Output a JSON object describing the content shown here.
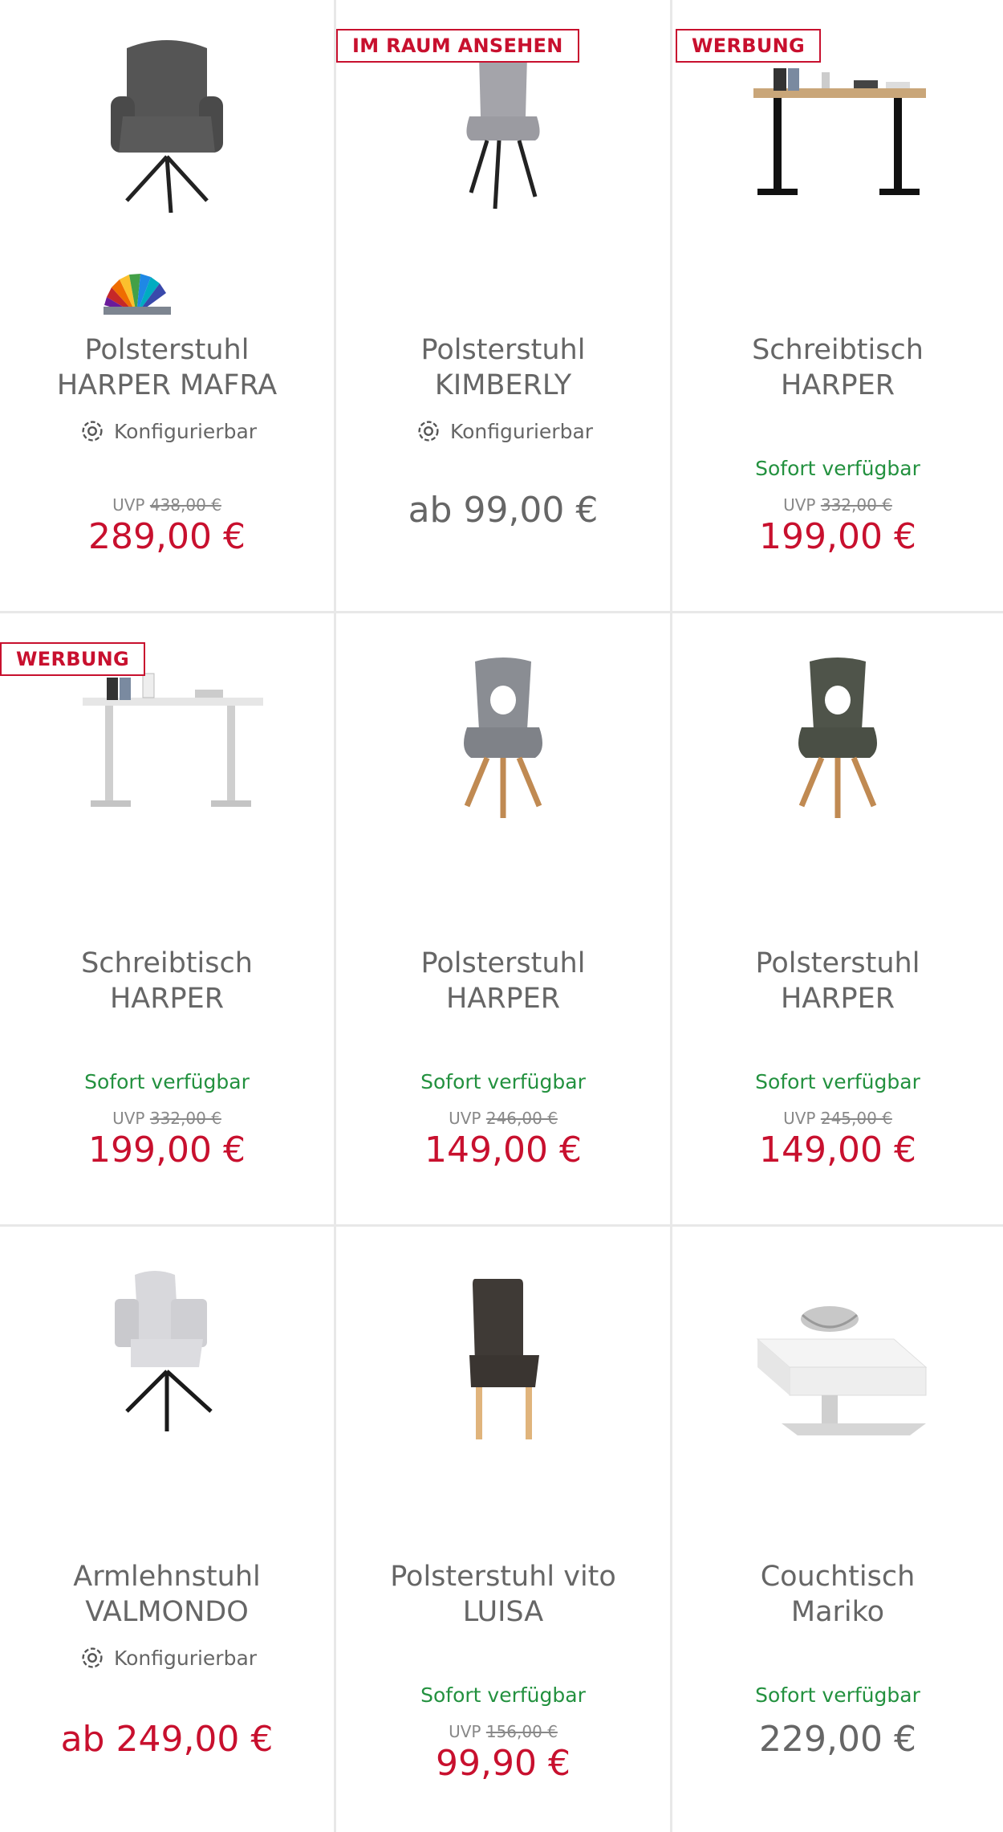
{
  "products": [
    {
      "title1": "Polsterstuhl",
      "title2": "HARPER MAFRA",
      "badge": "",
      "config": "Konfigurierbar",
      "availability": "",
      "uvp_label": "UVP",
      "uvp": "438,00 €",
      "price": "289,00 €",
      "image": "armchair-grey-icon"
    },
    {
      "title1": "Polsterstuhl",
      "title2": "KIMBERLY",
      "badge": "IM RAUM ANSEHEN",
      "config": "Konfigurierbar",
      "availability": "",
      "uvp_label": "",
      "uvp": "",
      "price": "ab 99,00 €",
      "image": "chair-light-grey-icon"
    },
    {
      "title1": "Schreibtisch",
      "title2": "HARPER",
      "badge": "WERBUNG",
      "config": "",
      "availability": "Sofort verfügbar",
      "uvp_label": "UVP",
      "uvp": "332,00 €",
      "price": "199,00 €",
      "image": "desk-black-icon"
    },
    {
      "title1": "Schreibtisch",
      "title2": "HARPER",
      "badge": "WERBUNG",
      "config": "",
      "availability": "Sofort verfügbar",
      "uvp_label": "UVP",
      "uvp": "332,00 €",
      "price": "199,00 €",
      "image": "desk-white-icon"
    },
    {
      "title1": "Polsterstuhl",
      "title2": "HARPER",
      "badge": "",
      "config": "",
      "availability": "Sofort verfügbar",
      "uvp_label": "UVP",
      "uvp": "246,00 €",
      "price": "149,00 €",
      "image": "chair-grey-wood-icon"
    },
    {
      "title1": "Polsterstuhl",
      "title2": "HARPER",
      "badge": "",
      "config": "",
      "availability": "Sofort verfügbar",
      "uvp_label": "UVP",
      "uvp": "245,00 €",
      "price": "149,00 €",
      "image": "chair-olive-wood-icon"
    },
    {
      "title1": "Armlehnstuhl",
      "title2": "VALMONDO",
      "badge": "",
      "config": "Konfigurierbar",
      "availability": "",
      "uvp_label": "",
      "uvp": "",
      "price": "ab 249,00 €",
      "image": "armchair-white-icon"
    },
    {
      "title1": "Polsterstuhl vito",
      "title2": "LUISA",
      "badge": "",
      "config": "",
      "availability": "Sofort verfügbar",
      "uvp_label": "UVP",
      "uvp": "156,00 €",
      "price": "99,90 €",
      "image": "chair-brown-icon"
    },
    {
      "title1": "Couchtisch",
      "title2": "Mariko",
      "badge": "",
      "config": "",
      "availability": "Sofort verfügbar",
      "uvp_label": "",
      "uvp": "",
      "price": "229,00 €",
      "image": "coffee-table-white-icon"
    }
  ],
  "colors": {
    "sale": "#c8102e",
    "available": "#23913f",
    "text": "#666666",
    "divider": "#e8e8e8"
  }
}
